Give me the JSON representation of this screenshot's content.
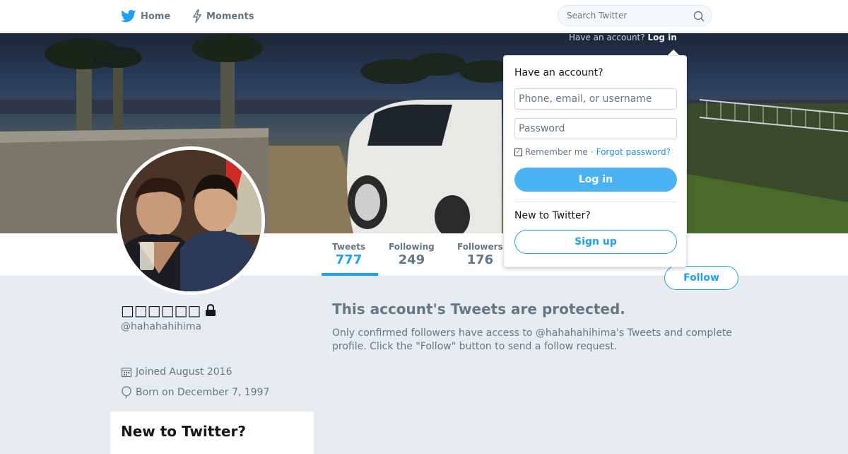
{
  "nav": {
    "home_label": "Home",
    "moments_label": "Moments",
    "search_placeholder": "Search Twitter",
    "have_account_prefix": "Have an account?",
    "log_in_link": "Log in"
  },
  "profile": {
    "display_name": "□□□□□□",
    "handle": "@hahahahihima",
    "joined": "Joined August 2016",
    "born": "Born on December 7, 1997",
    "follow_label": "Follow"
  },
  "stats": [
    {
      "label": "Tweets",
      "value": "777"
    },
    {
      "label": "Following",
      "value": "249"
    },
    {
      "label": "Followers",
      "value": "176"
    }
  ],
  "protected": {
    "title": "This account's Tweets are protected.",
    "body": "Only confirmed followers have access to @hahahahihima's Tweets and complete profile. Click the \"Follow\" button to send a follow request."
  },
  "sidebar_card": {
    "title": "New to Twitter?"
  },
  "login_popup": {
    "title": "Have an account?",
    "username_placeholder": "Phone, email, or username",
    "password_placeholder": "Password",
    "remember_label": "Remember me",
    "separator": "·",
    "forgot_label": "Forgot password?",
    "login_button": "Log in",
    "new_label": "New to Twitter?",
    "signup_button": "Sign up"
  },
  "colors": {
    "brand": "#1da1f2",
    "background": "#e6ecf0",
    "muted_text": "#657786"
  }
}
